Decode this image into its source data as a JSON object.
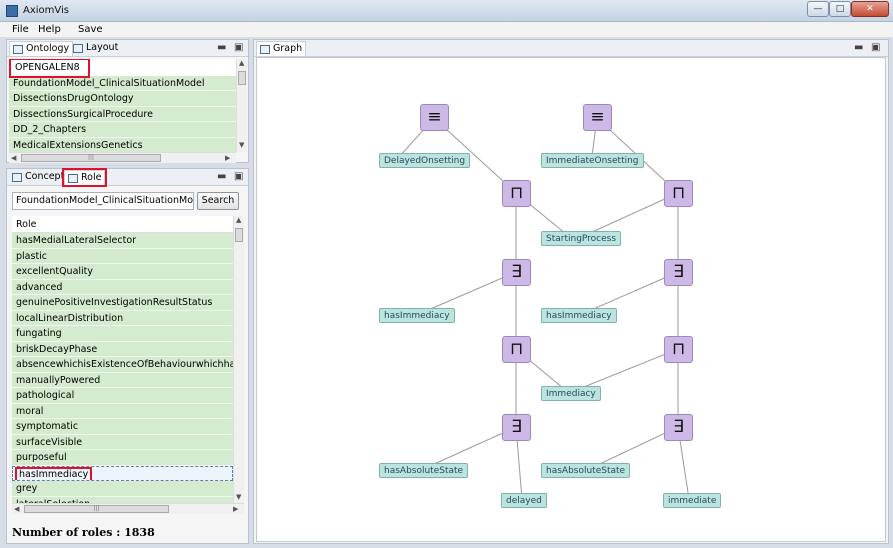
{
  "window": {
    "title": "AxiomVis",
    "controls": {
      "minimize": "—",
      "maximize": "□",
      "close": "✕"
    }
  },
  "menu": [
    "File",
    "Help",
    "Save"
  ],
  "ontology_pane": {
    "tabs": [
      "Ontology",
      "Layout"
    ],
    "selected": "OPENGALEN8",
    "items": [
      "FoundationModel_ClinicalSituationModel",
      "DissectionsDrugOntology",
      "DissectionsSurgicalProcedure",
      "DD_2_Chapters",
      "MedicalExtensionsGenetics"
    ]
  },
  "role_pane": {
    "tabs": [
      "Concept",
      "Role"
    ],
    "search_value": "FoundationModel_ClinicalSituationModel",
    "search_button": "Search",
    "column_header": "Role",
    "items": [
      "hasMedialLateralSelector",
      "plastic",
      "excellentQuality",
      "advanced",
      "genuinePositiveInvestigationResultStatus",
      "localLinearDistribution",
      "fungating",
      "briskDecayPhase",
      "absencewhichisExistenceOfBehaviourwhichhasIntrinsicallyNormalityStatus",
      "manuallyPowered",
      "pathological",
      "moral",
      "symptomatic",
      "surfaceVisible",
      "purposeful",
      "hasImmediacy",
      "grey",
      "lateralSelection"
    ],
    "selected_index": 15,
    "count_label": "Number of roles : 1838"
  },
  "graph_pane": {
    "tab": "Graph",
    "operators": {
      "equiv": "≡",
      "and": "⊓",
      "exists": "∃"
    },
    "labels": {
      "delayed_onsetting": "DelayedOnsetting",
      "immediate_onsetting": "ImmediateOnsetting",
      "starting_process": "StartingProcess",
      "has_immediacy": "hasImmediacy",
      "immediacy": "Immediacy",
      "has_absolute_state": "hasAbsoluteState",
      "delayed": "delayed",
      "immediate": "immediate"
    }
  },
  "colors": {
    "operator_node": "#cdb9e6",
    "label_node": "#bde3de",
    "list_row": "#d5ebd0",
    "highlight": "#e0112b"
  }
}
